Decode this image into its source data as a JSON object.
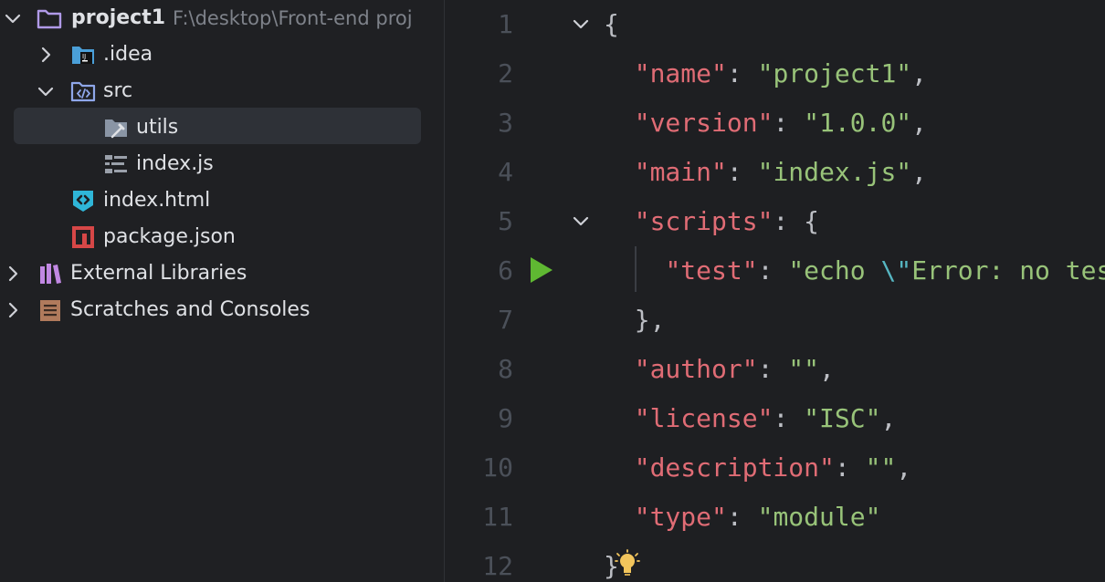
{
  "tree": {
    "root": {
      "name": "project1",
      "path": "F:\\desktop\\Front-end proj",
      "expanded": true
    },
    "items": [
      {
        "label": "project1",
        "icon": "folder-icon",
        "expanded": true
      },
      {
        "label": ".idea",
        "icon": "idea-folder-icon",
        "expanded": false
      },
      {
        "label": "src",
        "icon": "source-folder-icon",
        "expanded": true
      },
      {
        "label": "utils",
        "icon": "utils-folder-icon",
        "selected": true
      },
      {
        "label": "index.js",
        "icon": "js-file-icon"
      },
      {
        "label": "index.html",
        "icon": "html-file-icon"
      },
      {
        "label": "package.json",
        "icon": "npm-package-icon"
      },
      {
        "label": "External Libraries",
        "icon": "library-icon",
        "expanded": false
      },
      {
        "label": "Scratches and Consoles",
        "icon": "scratches-icon",
        "expanded": false
      }
    ]
  },
  "editor": {
    "line_numbers": [
      "1",
      "2",
      "3",
      "4",
      "5",
      "6",
      "7",
      "8",
      "9",
      "10",
      "11",
      "12"
    ],
    "lines": [
      {
        "parts": [
          {
            "t": "{",
            "c": "p"
          }
        ]
      },
      {
        "parts": [
          {
            "t": "  ",
            "c": "p"
          },
          {
            "t": "\"name\"",
            "c": "k"
          },
          {
            "t": ": ",
            "c": "p"
          },
          {
            "t": "\"project1\"",
            "c": "s"
          },
          {
            "t": ",",
            "c": "p"
          }
        ]
      },
      {
        "parts": [
          {
            "t": "  ",
            "c": "p"
          },
          {
            "t": "\"version\"",
            "c": "k"
          },
          {
            "t": ": ",
            "c": "p"
          },
          {
            "t": "\"1.0.0\"",
            "c": "s"
          },
          {
            "t": ",",
            "c": "p"
          }
        ]
      },
      {
        "parts": [
          {
            "t": "  ",
            "c": "p"
          },
          {
            "t": "\"main\"",
            "c": "k"
          },
          {
            "t": ": ",
            "c": "p"
          },
          {
            "t": "\"index.js\"",
            "c": "s"
          },
          {
            "t": ",",
            "c": "p"
          }
        ]
      },
      {
        "parts": [
          {
            "t": "  ",
            "c": "p"
          },
          {
            "t": "\"scripts\"",
            "c": "k"
          },
          {
            "t": ": {",
            "c": "p"
          }
        ]
      },
      {
        "parts": [
          {
            "t": "    ",
            "c": "p"
          },
          {
            "t": "\"test\"",
            "c": "k"
          },
          {
            "t": ": ",
            "c": "p"
          },
          {
            "t": "\"echo ",
            "c": "s"
          },
          {
            "t": "\\\"",
            "c": "esc"
          },
          {
            "t": "Error: no test specified",
            "c": "s"
          }
        ]
      },
      {
        "parts": [
          {
            "t": "  },",
            "c": "p"
          }
        ]
      },
      {
        "parts": [
          {
            "t": "  ",
            "c": "p"
          },
          {
            "t": "\"author\"",
            "c": "k"
          },
          {
            "t": ": ",
            "c": "p"
          },
          {
            "t": "\"\"",
            "c": "s"
          },
          {
            "t": ",",
            "c": "p"
          }
        ]
      },
      {
        "parts": [
          {
            "t": "  ",
            "c": "p"
          },
          {
            "t": "\"license\"",
            "c": "k"
          },
          {
            "t": ": ",
            "c": "p"
          },
          {
            "t": "\"ISC\"",
            "c": "s"
          },
          {
            "t": ",",
            "c": "p"
          }
        ]
      },
      {
        "parts": [
          {
            "t": "  ",
            "c": "p"
          },
          {
            "t": "\"description\"",
            "c": "k"
          },
          {
            "t": ": ",
            "c": "p"
          },
          {
            "t": "\"\"",
            "c": "s"
          },
          {
            "t": ",",
            "c": "p"
          }
        ]
      },
      {
        "parts": [
          {
            "t": "  ",
            "c": "p"
          },
          {
            "t": "\"type\"",
            "c": "k"
          },
          {
            "t": ": ",
            "c": "p"
          },
          {
            "t": "\"module\"",
            "c": "s"
          }
        ]
      },
      {
        "parts": [
          {
            "t": "}",
            "c": "p"
          }
        ]
      }
    ],
    "run_gutter_icon": "run-icon",
    "intention_icon": "lightbulb-icon"
  },
  "colors": {
    "key": "#e06c75",
    "string": "#98c379",
    "punct": "#bcbec4",
    "line_number": "#4b5059",
    "run": "#5fb832",
    "bulb": "#f2c55c"
  }
}
